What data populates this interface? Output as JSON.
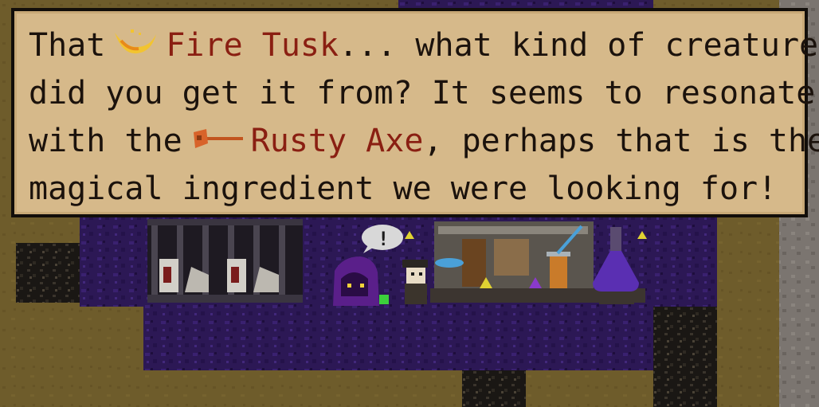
{
  "dialog": {
    "line1_a": "That",
    "item1_name": "Fire Tusk",
    "line1_b": "... what kind of creature",
    "line2": "did you get it from? It seems to resonate",
    "line3_a": "with the",
    "item2_name": "Rusty Axe",
    "line3_b": ", perhaps that is the",
    "line4": "magical ingredient we were looking for!",
    "item1_icon": "fire-tusk-icon",
    "item2_icon": "rusty-axe-icon",
    "item_color": "#8a1f12",
    "text_color": "#1b120c",
    "box_color": "#d6b98a"
  },
  "npc": {
    "speech_bubble_text": "!"
  }
}
